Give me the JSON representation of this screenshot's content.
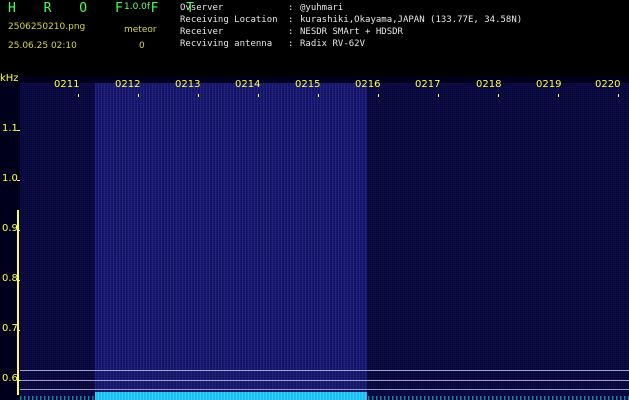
{
  "header": {
    "brand": "H R O F F T",
    "version": "1.0.0f",
    "filename": "2506250210.png",
    "meteor_label": "meteor",
    "datetime": "25.06.25 02:10",
    "meteor_count": "0",
    "info": [
      {
        "key": "Ovserver",
        "value": "@yuhmari"
      },
      {
        "key": "Receiving Location",
        "value": "kurashiki,Okayama,JAPAN (133.77E, 34.58N)"
      },
      {
        "key": "Receiver",
        "value": "NESDR SMArt + HDSDR"
      },
      {
        "key": "Recviving antenna",
        "value": "Radix RV-62V"
      }
    ]
  },
  "spectrogram": {
    "y_unit": "kHz",
    "y_ticks": [
      "1.1",
      "1.0",
      "0.9",
      "0.8",
      "0.7",
      "0.6"
    ],
    "x_ticks": [
      "0211",
      "0212",
      "0213",
      "0214",
      "0215",
      "0216",
      "0217",
      "0218",
      "0219",
      "0220"
    ],
    "colors": {
      "background": "#00001c",
      "signal": "#3a3aff",
      "floor": "#29d3ff",
      "labels": "#ffff40"
    }
  }
}
